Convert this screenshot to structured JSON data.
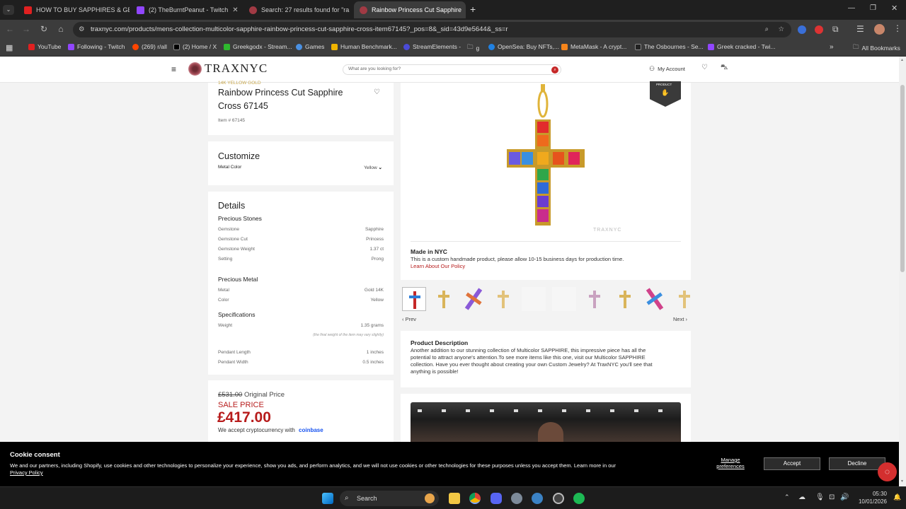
{
  "browser": {
    "tabs": [
      {
        "title": "HOW TO BUY SAPPHIRES & GE"
      },
      {
        "title": "(2) TheBurntPeanut - Twitch"
      },
      {
        "title": "Search: 27 results found for \"ra"
      },
      {
        "title": "Rainbow Princess Cut Sapphire"
      }
    ],
    "url": "traxnyc.com/products/mens-collection-multicolor-sapphire-rainbow-princess-cut-sapphire-cross-item67145?_pos=8&_sid=43d9e5644&_ss=r",
    "bookmarks": [
      "YouTube",
      "Following - Twitch",
      "(269) r/all",
      "(2) Home / X",
      "Greekgodx - Stream...",
      "Games",
      "Human Benchmark...",
      "StreamElements -",
      "g",
      "OpenSea: Buy NFTs,...",
      "MetaMask - A crypt...",
      "The Osbournes - Se...",
      "Greek cracked - Twi..."
    ],
    "all_bookmarks": "All Bookmarks"
  },
  "site": {
    "logo": "TRAXNYC",
    "search_placeholder": "What are you looking for?",
    "account": "My Account"
  },
  "product": {
    "category": "14K YELLOW GOLD",
    "title_line1": "Rainbow Princess Cut Sapphire",
    "title_line2": "Cross 67145",
    "item_no": "Item # 67145",
    "customize": {
      "heading": "Customize",
      "metal_label": "Metal Color",
      "metal_value": "Yellow"
    },
    "details": {
      "heading": "Details",
      "stones_heading": "Precious Stones",
      "stones": [
        {
          "label": "Gemstone",
          "value": "Sapphire"
        },
        {
          "label": "Gemstone Cut",
          "value": "Princess"
        },
        {
          "label": "Gemstone Weight",
          "value": "1.37 ct"
        },
        {
          "label": "Setting",
          "value": "Prong"
        }
      ],
      "metal_heading": "Precious Metal",
      "metal": [
        {
          "label": "Metal",
          "value": "Gold 14K"
        },
        {
          "label": "Color",
          "value": "Yellow"
        }
      ],
      "spec_heading": "Specifications",
      "weight_label": "Weight",
      "weight_value": "1.35 grams",
      "weight_note": "(the final weight of the item may vary slightly)",
      "length_label": "Pendant Length",
      "length_value": "1 inches",
      "width_label": "Pendant Width",
      "width_value": "0.5 inches"
    },
    "price": {
      "original": "£531.00",
      "original_label": "Original Price",
      "sale_label": "SALE PRICE",
      "sale": "£417.00",
      "crypto": "We accept cryptocurrency with",
      "crypto_brand": "coinbase"
    },
    "badge": "PRODUCT",
    "watermark": "TRAXNYC",
    "made_heading": "Made in NYC",
    "made_text": "This is a custom handmade product, please allow 10-15 business days for production time.",
    "policy_link": "Learn About Our Policy",
    "prev": "Prev",
    "next": "Next",
    "desc_heading": "Product Description",
    "desc_line1": "Another addition to our stunning collection of Multicolor SAPPHIRE, this impressive piece has all the",
    "desc_line2": "potential to attract anyone's attention.To see more items like this one, visit our Multicolor SAPPHIRE",
    "desc_line3": "collection. Have you ever thought about creating your own Custom Jewelry? At TraxNYC you'll see that",
    "desc_line4": "anything is possible!"
  },
  "cookie": {
    "title": "Cookie consent",
    "text": "We and our partners, including Shopify, use cookies and other technologies to personalize your experience, show you ads, and perform analytics, and we will not use cookies or other technologies for these purposes unless you accept them. Learn more in our",
    "policy": "Privacy Policy",
    "manage1": "Manage",
    "manage2": "preferences",
    "accept": "Accept",
    "decline": "Decline"
  },
  "taskbar": {
    "search": "Search",
    "time": "05:30",
    "date": "10/01/2026"
  },
  "colors": {
    "brand_red": "#b0262b",
    "accent": "#d32f2f",
    "sale_red": "#b71c1c"
  }
}
